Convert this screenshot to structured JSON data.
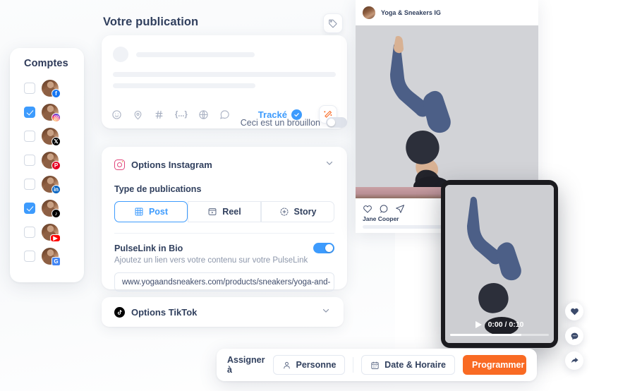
{
  "accounts_panel": {
    "title": "Comptes",
    "items": [
      {
        "platform": "facebook",
        "icon": "facebook-icon",
        "checked": false
      },
      {
        "platform": "instagram",
        "icon": "instagram-icon",
        "checked": true
      },
      {
        "platform": "x",
        "icon": "x-twitter-icon",
        "checked": false
      },
      {
        "platform": "pinterest",
        "icon": "pinterest-icon",
        "checked": false
      },
      {
        "platform": "linkedin",
        "icon": "linkedin-icon",
        "checked": false
      },
      {
        "platform": "tiktok",
        "icon": "tiktok-icon",
        "checked": true
      },
      {
        "platform": "youtube",
        "icon": "youtube-icon",
        "checked": false
      },
      {
        "platform": "google_business",
        "icon": "google-business-icon",
        "checked": false
      }
    ]
  },
  "composer": {
    "title": "Votre publication",
    "tag_button_icon": "tag-icon",
    "toolbar_icons": [
      "emoji-icon",
      "location-pin-icon",
      "hashtag-icon",
      "variable-braces-icon",
      "globe-icon",
      "comment-icon"
    ],
    "tracked_label": "Tracké",
    "tracked_badge_icon": "check-badge-icon",
    "magic_icon": "magic-wand-icon",
    "draft_label": "Ceci est un brouillon",
    "draft_enabled": false
  },
  "instagram_options": {
    "title": "Options Instagram",
    "icon": "instagram-icon",
    "chevron_icon": "chevron-down-icon",
    "post_type_label": "Type de publications",
    "types": [
      {
        "label": "Post",
        "icon": "grid-icon",
        "active": true
      },
      {
        "label": "Reel",
        "icon": "reel-icon",
        "active": false
      },
      {
        "label": "Story",
        "icon": "story-plus-icon",
        "active": false
      }
    ],
    "pulselink": {
      "title": "PulseLink in Bio",
      "subtitle": "Ajoutez un lien vers votre contenu sur votre PulseLink",
      "enabled": true,
      "url": "www.yogaandsneakers.com/products/sneakers/yoga-and-"
    }
  },
  "tiktok_options": {
    "title": "Options TikTok",
    "icon": "tiktok-icon",
    "chevron_icon": "chevron-down-icon"
  },
  "preview": {
    "account_name": "Yoga & Sneakers IG",
    "avatar": "avatar",
    "actions": [
      "heart-icon",
      "comment-icon",
      "share-icon"
    ],
    "caption_author": "Jane Cooper"
  },
  "video": {
    "play_icon": "play-icon",
    "time": "0:00 / 0:10"
  },
  "floating_actions": [
    {
      "icon": "heart-filled-icon"
    },
    {
      "icon": "comment-dots-icon"
    },
    {
      "icon": "share-arrow-icon"
    }
  ],
  "action_bar": {
    "assign_label": "Assigner à",
    "person_label": "Personne",
    "person_icon": "person-icon",
    "date_label": "Date & Horaire",
    "date_icon": "calendar-icon",
    "schedule_label": "Programmer",
    "schedule_chevron_icon": "chevron-down-icon"
  },
  "colors": {
    "accent_blue": "#3d9bfd",
    "accent_orange": "#f96a23",
    "text_dark": "#31405e",
    "text_muted": "#8d97ab"
  }
}
